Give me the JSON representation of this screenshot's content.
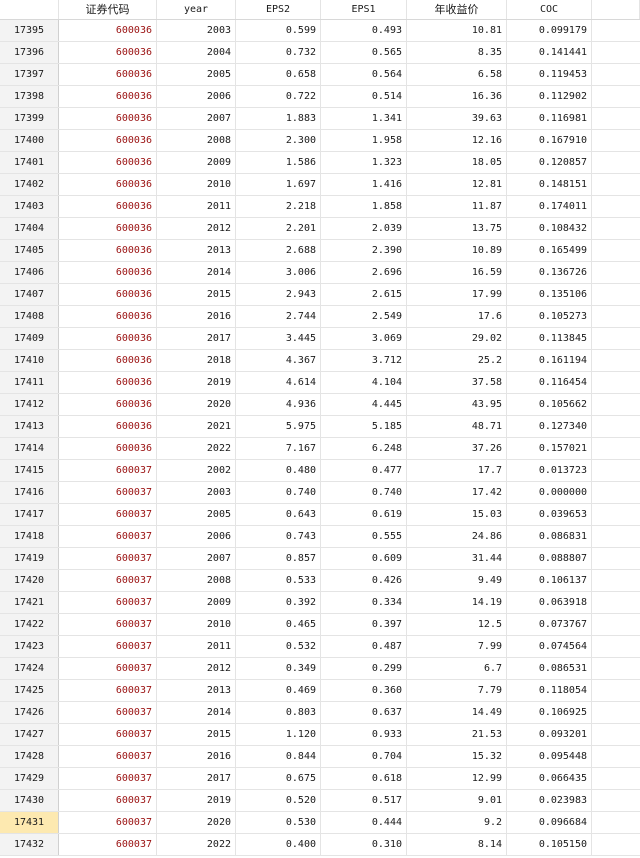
{
  "columns": [
    "",
    "证券代码",
    "year",
    "EPS2",
    "EPS1",
    "年收益价",
    "COC"
  ],
  "selected_row": "17431",
  "rows": [
    [
      "17395",
      "600036",
      "2003",
      "0.599",
      "0.493",
      "10.81",
      "0.099179"
    ],
    [
      "17396",
      "600036",
      "2004",
      "0.732",
      "0.565",
      "8.35",
      "0.141441"
    ],
    [
      "17397",
      "600036",
      "2005",
      "0.658",
      "0.564",
      "6.58",
      "0.119453"
    ],
    [
      "17398",
      "600036",
      "2006",
      "0.722",
      "0.514",
      "16.36",
      "0.112902"
    ],
    [
      "17399",
      "600036",
      "2007",
      "1.883",
      "1.341",
      "39.63",
      "0.116981"
    ],
    [
      "17400",
      "600036",
      "2008",
      "2.300",
      "1.958",
      "12.16",
      "0.167910"
    ],
    [
      "17401",
      "600036",
      "2009",
      "1.586",
      "1.323",
      "18.05",
      "0.120857"
    ],
    [
      "17402",
      "600036",
      "2010",
      "1.697",
      "1.416",
      "12.81",
      "0.148151"
    ],
    [
      "17403",
      "600036",
      "2011",
      "2.218",
      "1.858",
      "11.87",
      "0.174011"
    ],
    [
      "17404",
      "600036",
      "2012",
      "2.201",
      "2.039",
      "13.75",
      "0.108432"
    ],
    [
      "17405",
      "600036",
      "2013",
      "2.688",
      "2.390",
      "10.89",
      "0.165499"
    ],
    [
      "17406",
      "600036",
      "2014",
      "3.006",
      "2.696",
      "16.59",
      "0.136726"
    ],
    [
      "17407",
      "600036",
      "2015",
      "2.943",
      "2.615",
      "17.99",
      "0.135106"
    ],
    [
      "17408",
      "600036",
      "2016",
      "2.744",
      "2.549",
      "17.6",
      "0.105273"
    ],
    [
      "17409",
      "600036",
      "2017",
      "3.445",
      "3.069",
      "29.02",
      "0.113845"
    ],
    [
      "17410",
      "600036",
      "2018",
      "4.367",
      "3.712",
      "25.2",
      "0.161194"
    ],
    [
      "17411",
      "600036",
      "2019",
      "4.614",
      "4.104",
      "37.58",
      "0.116454"
    ],
    [
      "17412",
      "600036",
      "2020",
      "4.936",
      "4.445",
      "43.95",
      "0.105662"
    ],
    [
      "17413",
      "600036",
      "2021",
      "5.975",
      "5.185",
      "48.71",
      "0.127340"
    ],
    [
      "17414",
      "600036",
      "2022",
      "7.167",
      "6.248",
      "37.26",
      "0.157021"
    ],
    [
      "17415",
      "600037",
      "2002",
      "0.480",
      "0.477",
      "17.7",
      "0.013723"
    ],
    [
      "17416",
      "600037",
      "2003",
      "0.740",
      "0.740",
      "17.42",
      "0.000000"
    ],
    [
      "17417",
      "600037",
      "2005",
      "0.643",
      "0.619",
      "15.03",
      "0.039653"
    ],
    [
      "17418",
      "600037",
      "2006",
      "0.743",
      "0.555",
      "24.86",
      "0.086831"
    ],
    [
      "17419",
      "600037",
      "2007",
      "0.857",
      "0.609",
      "31.44",
      "0.088807"
    ],
    [
      "17420",
      "600037",
      "2008",
      "0.533",
      "0.426",
      "9.49",
      "0.106137"
    ],
    [
      "17421",
      "600037",
      "2009",
      "0.392",
      "0.334",
      "14.19",
      "0.063918"
    ],
    [
      "17422",
      "600037",
      "2010",
      "0.465",
      "0.397",
      "12.5",
      "0.073767"
    ],
    [
      "17423",
      "600037",
      "2011",
      "0.532",
      "0.487",
      "7.99",
      "0.074564"
    ],
    [
      "17424",
      "600037",
      "2012",
      "0.349",
      "0.299",
      "6.7",
      "0.086531"
    ],
    [
      "17425",
      "600037",
      "2013",
      "0.469",
      "0.360",
      "7.79",
      "0.118054"
    ],
    [
      "17426",
      "600037",
      "2014",
      "0.803",
      "0.637",
      "14.49",
      "0.106925"
    ],
    [
      "17427",
      "600037",
      "2015",
      "1.120",
      "0.933",
      "21.53",
      "0.093201"
    ],
    [
      "17428",
      "600037",
      "2016",
      "0.844",
      "0.704",
      "15.32",
      "0.095448"
    ],
    [
      "17429",
      "600037",
      "2017",
      "0.675",
      "0.618",
      "12.99",
      "0.066435"
    ],
    [
      "17430",
      "600037",
      "2019",
      "0.520",
      "0.517",
      "9.01",
      "0.023983"
    ],
    [
      "17431",
      "600037",
      "2020",
      "0.530",
      "0.444",
      "9.2",
      "0.096684"
    ],
    [
      "17432",
      "600037",
      "2022",
      "0.400",
      "0.310",
      "8.14",
      "0.105150"
    ]
  ]
}
